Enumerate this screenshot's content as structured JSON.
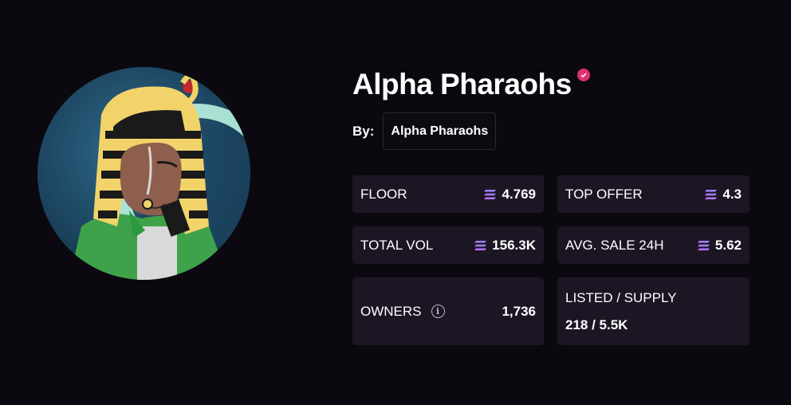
{
  "collection": {
    "name": "Alpha Pharaohs",
    "by_label": "By:",
    "creator": "Alpha Pharaohs",
    "verified_icon": "verified-badge-icon",
    "avatar_icon": "pharaoh-avatar-image"
  },
  "stats": {
    "floor": {
      "label": "FLOOR",
      "value": "4.769",
      "icon": "solana-icon"
    },
    "top_offer": {
      "label": "TOP OFFER",
      "value": "4.3",
      "icon": "solana-icon"
    },
    "total_vol": {
      "label": "TOTAL VOL",
      "value": "156.3K",
      "icon": "solana-icon"
    },
    "avg_sale": {
      "label": "AVG. SALE 24H",
      "value": "5.62",
      "icon": "solana-icon"
    },
    "owners": {
      "label": "OWNERS",
      "value": "1,736",
      "icon": "info-icon"
    },
    "listed": {
      "label": "LISTED / SUPPLY",
      "value": "218 / 5.5K"
    }
  },
  "colors": {
    "background": "#0b080f",
    "card": "#1c1624",
    "verified": "#e0316e",
    "solana_gradient": [
      "#9945ff",
      "#19fb9b"
    ]
  }
}
